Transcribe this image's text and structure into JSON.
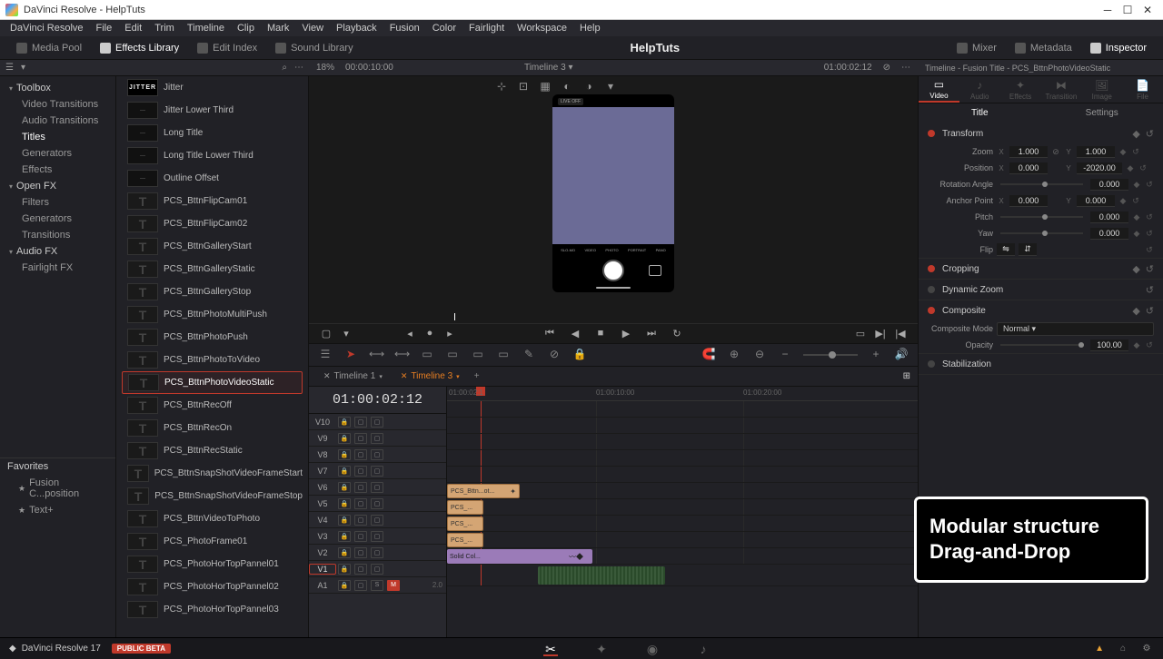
{
  "app": {
    "title": "DaVinci Resolve - HelpTuts",
    "name": "DaVinci Resolve 17",
    "badge": "PUBLIC BETA"
  },
  "menus": [
    "DaVinci Resolve",
    "File",
    "Edit",
    "Trim",
    "Timeline",
    "Clip",
    "Mark",
    "View",
    "Playback",
    "Fusion",
    "Color",
    "Fairlight",
    "Workspace",
    "Help"
  ],
  "toolbar": {
    "left": [
      {
        "label": "Media Pool",
        "active": false
      },
      {
        "label": "Effects Library",
        "active": true
      },
      {
        "label": "Edit Index",
        "active": false
      },
      {
        "label": "Sound Library",
        "active": false
      }
    ],
    "center": "HelpTuts",
    "right": [
      {
        "label": "Mixer",
        "active": false
      },
      {
        "label": "Metadata",
        "active": false
      },
      {
        "label": "Inspector",
        "active": true
      }
    ]
  },
  "subbar": {
    "zoom": "18%",
    "start_tc": "00:00:10:00",
    "timeline_name": "Timeline 3",
    "pos_tc": "01:00:02:12",
    "insp_title": "Timeline - Fusion Title - PCS_BttnPhotoVideoStatic"
  },
  "sidebar": {
    "toolbox": {
      "label": "Toolbox",
      "items": [
        "Video Transitions",
        "Audio Transitions",
        "Titles",
        "Generators",
        "Effects"
      ],
      "selected": "Titles"
    },
    "openfx": {
      "label": "Open FX",
      "items": [
        "Filters",
        "Generators",
        "Transitions"
      ]
    },
    "audiofx": {
      "label": "Audio FX",
      "items": [
        "Fairlight FX"
      ]
    },
    "favorites_hdr": "Favorites",
    "favorites": [
      "Fusion C...position",
      "Text+"
    ]
  },
  "titles": {
    "jitter_cat": "JITTER",
    "list": [
      {
        "label": "Jitter",
        "thumb": "jitter"
      },
      {
        "label": "Jitter Lower Third",
        "thumb": "line"
      },
      {
        "label": "Long Title",
        "thumb": "line"
      },
      {
        "label": "Long Title Lower Third",
        "thumb": "line"
      },
      {
        "label": "Outline Offset",
        "thumb": "outline"
      },
      {
        "label": "PCS_BttnFlipCam01",
        "thumb": "t"
      },
      {
        "label": "PCS_BttnFlipCam02",
        "thumb": "t"
      },
      {
        "label": "PCS_BttnGalleryStart",
        "thumb": "t"
      },
      {
        "label": "PCS_BttnGalleryStatic",
        "thumb": "t"
      },
      {
        "label": "PCS_BttnGalleryStop",
        "thumb": "t"
      },
      {
        "label": "PCS_BttnPhotoMultiPush",
        "thumb": "t"
      },
      {
        "label": "PCS_BttnPhotoPush",
        "thumb": "t"
      },
      {
        "label": "PCS_BttnPhotoToVideo",
        "thumb": "t"
      },
      {
        "label": "PCS_BttnPhotoVideoStatic",
        "thumb": "t",
        "selected": true
      },
      {
        "label": "PCS_BttnRecOff",
        "thumb": "t"
      },
      {
        "label": "PCS_BttnRecOn",
        "thumb": "t"
      },
      {
        "label": "PCS_BttnRecStatic",
        "thumb": "t"
      },
      {
        "label": "PCS_BttnSnapShotVideoFrameStart",
        "thumb": "t"
      },
      {
        "label": "PCS_BttnSnapShotVideoFrameStop",
        "thumb": "t"
      },
      {
        "label": "PCS_BttnVideoToPhoto",
        "thumb": "t"
      },
      {
        "label": "PCS_PhotoFrame01",
        "thumb": "t"
      },
      {
        "label": "PCS_PhotoHorTopPannel01",
        "thumb": "t"
      },
      {
        "label": "PCS_PhotoHorTopPannel02",
        "thumb": "t"
      },
      {
        "label": "PCS_PhotoHorTopPannel03",
        "thumb": "t"
      }
    ]
  },
  "viewer": {
    "live_badge": "LIVE OFF",
    "modes": [
      "SLO-MO",
      "VIDEO",
      "PHOTO",
      "PORTRAIT",
      "PANO"
    ]
  },
  "tabs": [
    {
      "label": "Timeline 1",
      "active": false
    },
    {
      "label": "Timeline 3",
      "active": true
    }
  ],
  "timecode": "01:00:02:12",
  "ruler": [
    "01:00:02:1",
    "01:00:10:00",
    "01:00:20:00"
  ],
  "tracks": {
    "video": [
      "V10",
      "V9",
      "V8",
      "V7",
      "V6",
      "V5",
      "V4",
      "V3",
      "V2",
      "V1"
    ],
    "audio": {
      "name": "A1",
      "meter": "2.0",
      "mute": "M",
      "solo": "S"
    }
  },
  "clips": {
    "v5": "PCS_Bttn...ot...",
    "v4": "PCS_...",
    "v3": "PCS_...",
    "v2": "PCS_...",
    "v1": "Solid Col..."
  },
  "inspector": {
    "tabs": [
      "Video",
      "Audio",
      "Effects",
      "Transition",
      "Image",
      "File"
    ],
    "active_tab": "Video",
    "subtabs": [
      "Title",
      "Settings"
    ],
    "active_subtab": "Title",
    "transform": {
      "label": "Transform",
      "zoom": {
        "label": "Zoom",
        "x": "1.000",
        "y": "1.000"
      },
      "position": {
        "label": "Position",
        "x": "0.000",
        "y": "-2020.00"
      },
      "rotation": {
        "label": "Rotation Angle",
        "val": "0.000"
      },
      "anchor": {
        "label": "Anchor Point",
        "x": "0.000",
        "y": "0.000"
      },
      "pitch": {
        "label": "Pitch",
        "val": "0.000"
      },
      "yaw": {
        "label": "Yaw",
        "val": "0.000"
      },
      "flip": {
        "label": "Flip"
      }
    },
    "cropping": {
      "label": "Cropping"
    },
    "dynamic_zoom": {
      "label": "Dynamic Zoom"
    },
    "composite": {
      "label": "Composite",
      "mode": {
        "label": "Composite Mode",
        "val": "Normal"
      },
      "opacity": {
        "label": "Opacity",
        "val": "100.00"
      }
    },
    "stabilization": {
      "label": "Stabilization"
    }
  },
  "overlay": {
    "line1": "Modular structure",
    "line2": "Drag-and-Drop"
  }
}
